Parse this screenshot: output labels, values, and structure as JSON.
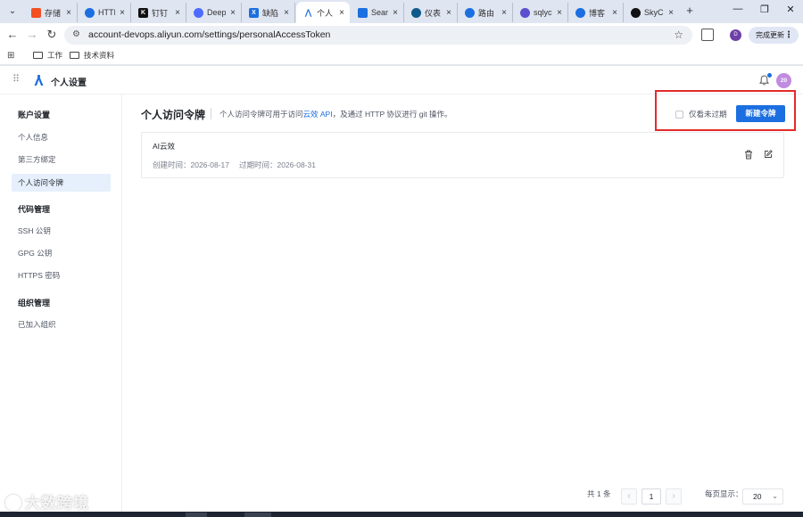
{
  "browser": {
    "tabs": [
      {
        "label": "存储",
        "favicon_color": "#f25022"
      },
      {
        "label": "HTTI",
        "favicon_color": "#1b6fe0"
      },
      {
        "label": "钉钉",
        "favicon_color": "#111111"
      },
      {
        "label": "Deep",
        "favicon_color": "#4d6bfe"
      },
      {
        "label": "缺陷",
        "favicon_color": "#1b6fe0"
      },
      {
        "label": "个人",
        "favicon_color": "#1b6fe0"
      },
      {
        "label": "Sear",
        "favicon_color": "#1b6fe0"
      },
      {
        "label": "仪表",
        "favicon_color": "#0e5a8a"
      },
      {
        "label": "路由",
        "favicon_color": "#1b6fe0"
      },
      {
        "label": "sqlyc",
        "favicon_color": "#5a4fcf"
      },
      {
        "label": "博客",
        "favicon_color": "#1b6fe0"
      },
      {
        "label": "SkyC",
        "favicon_color": "#111111"
      }
    ],
    "tab_close": "×",
    "new_tab": "+",
    "url": "account-devops.aliyun.com/settings/personalAccessToken",
    "profile_initial": "D",
    "update_button": "完成更新"
  },
  "bookmarks": [
    {
      "label": "工作"
    },
    {
      "label": "技术资料"
    }
  ],
  "app": {
    "title": "个人设置",
    "avatar_text": "20"
  },
  "sidebar": {
    "groups": [
      {
        "label": "账户设置",
        "items": [
          "个人信息",
          "第三方绑定",
          "个人访问令牌"
        ]
      },
      {
        "label": "代码管理",
        "items": [
          "SSH 公钥",
          "GPG 公钥",
          "HTTPS 密码"
        ]
      },
      {
        "label": "组织管理",
        "items": [
          "已加入组织"
        ]
      }
    ],
    "active_item": "个人访问令牌"
  },
  "main": {
    "title": "个人访问令牌",
    "desc_prefix": "个人访问令牌可用于访问",
    "desc_link": "云效 API",
    "desc_suffix": "，及通过 HTTP 协议进行 git 操作。",
    "filter_label": "仅看未过期",
    "new_button": "新建令牌"
  },
  "tokens": [
    {
      "name": "AI云效",
      "created": "创建时间：2026-08-17",
      "expires": "过期时间：2026-08-31"
    }
  ],
  "pagination": {
    "total": "共 1 条",
    "current_page": "1",
    "page_size_label": "每页显示：",
    "page_size": "20",
    "prev": "‹",
    "next": "›"
  },
  "watermark": "大数跨境",
  "colors": {
    "accent": "#1b6fe0",
    "highlight": "#e32b2b"
  }
}
